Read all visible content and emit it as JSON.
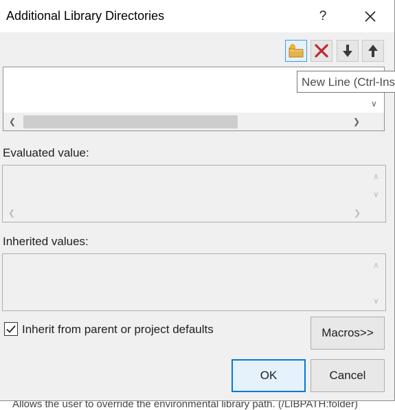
{
  "window": {
    "title": "Additional Library Directories",
    "help_label": "?"
  },
  "toolbar": {
    "new_line_tooltip": "New Line (Ctrl-Insert)",
    "icons": [
      "new-folder-icon",
      "delete-icon",
      "move-down-icon",
      "move-up-icon"
    ]
  },
  "sections": {
    "evaluated_label": "Evaluated value:",
    "inherited_label": "Inherited values:"
  },
  "inherit_checkbox": {
    "label": "Inherit from parent or project defaults",
    "checked": true
  },
  "buttons": {
    "macros": "Macros>>",
    "ok": "OK",
    "cancel": "Cancel"
  },
  "background_text": "Allows the user to override the environmental library path. (/LIBPATH:folder)",
  "colors": {
    "accent": "#0078d7",
    "delete_red": "#c0282f",
    "folder": "#e8b24a"
  }
}
